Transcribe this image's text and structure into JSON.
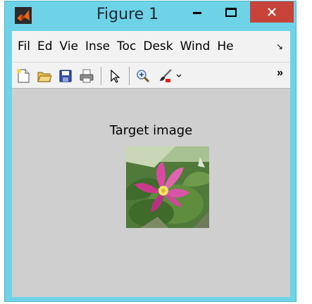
{
  "window": {
    "title": "Figure 1"
  },
  "menubar": {
    "items": [
      "Fil",
      "Ed",
      "Vie",
      "Inse",
      "Toc",
      "Desk",
      "Wind",
      "He"
    ],
    "overflow_glyph": "↘"
  },
  "toolbar": {
    "buttons": [
      "new-figure-icon",
      "open-file-icon",
      "save-icon",
      "print-icon",
      "select-arrow-icon",
      "zoom-in-icon",
      "brush-icon"
    ],
    "overflow_glyph": "»"
  },
  "axes": {
    "title": "Target image"
  },
  "colors": {
    "titlebar": "#6fd3e8",
    "close_button": "#c7433a",
    "figure_background": "#cfcfcf",
    "menubar": "#f2f2f2"
  }
}
